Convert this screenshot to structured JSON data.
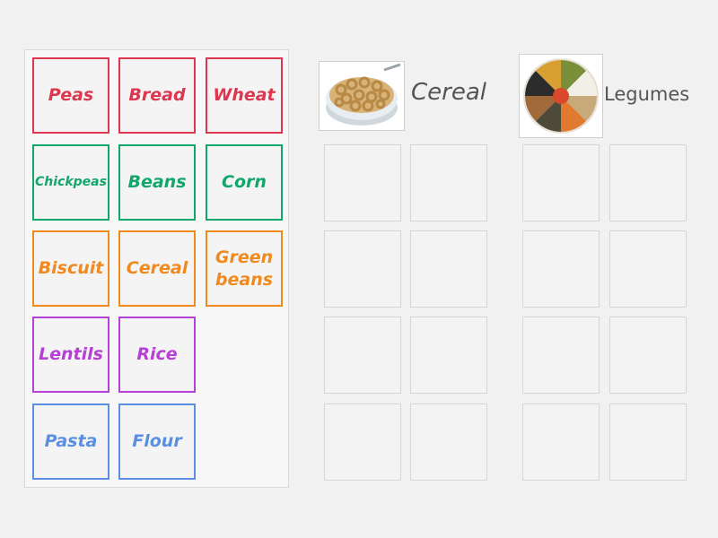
{
  "items": [
    {
      "label": "Peas",
      "color": "#dd3650"
    },
    {
      "label": "Bread",
      "color": "#dd3650"
    },
    {
      "label": "Wheat",
      "color": "#dd3650"
    },
    {
      "label": "Chickpeas",
      "color": "#12a66a"
    },
    {
      "label": "Beans",
      "color": "#12a66a"
    },
    {
      "label": "Corn",
      "color": "#12a66a"
    },
    {
      "label": "Biscuit",
      "color": "#f08a1e"
    },
    {
      "label": "Cereal",
      "color": "#f08a1e"
    },
    {
      "label": "Green beans",
      "color": "#f08a1e"
    },
    {
      "label": "Lentils",
      "color": "#b63fd4"
    },
    {
      "label": "Rice",
      "color": "#b63fd4"
    },
    {
      "label": "Pasta",
      "color": "#5a8fe2"
    },
    {
      "label": "Flour",
      "color": "#5a8fe2"
    }
  ],
  "groups": [
    {
      "title": "Cereal",
      "image": "cereal-bowl-image"
    },
    {
      "title": "Legumes",
      "image": "legumes-plate-image"
    }
  ]
}
